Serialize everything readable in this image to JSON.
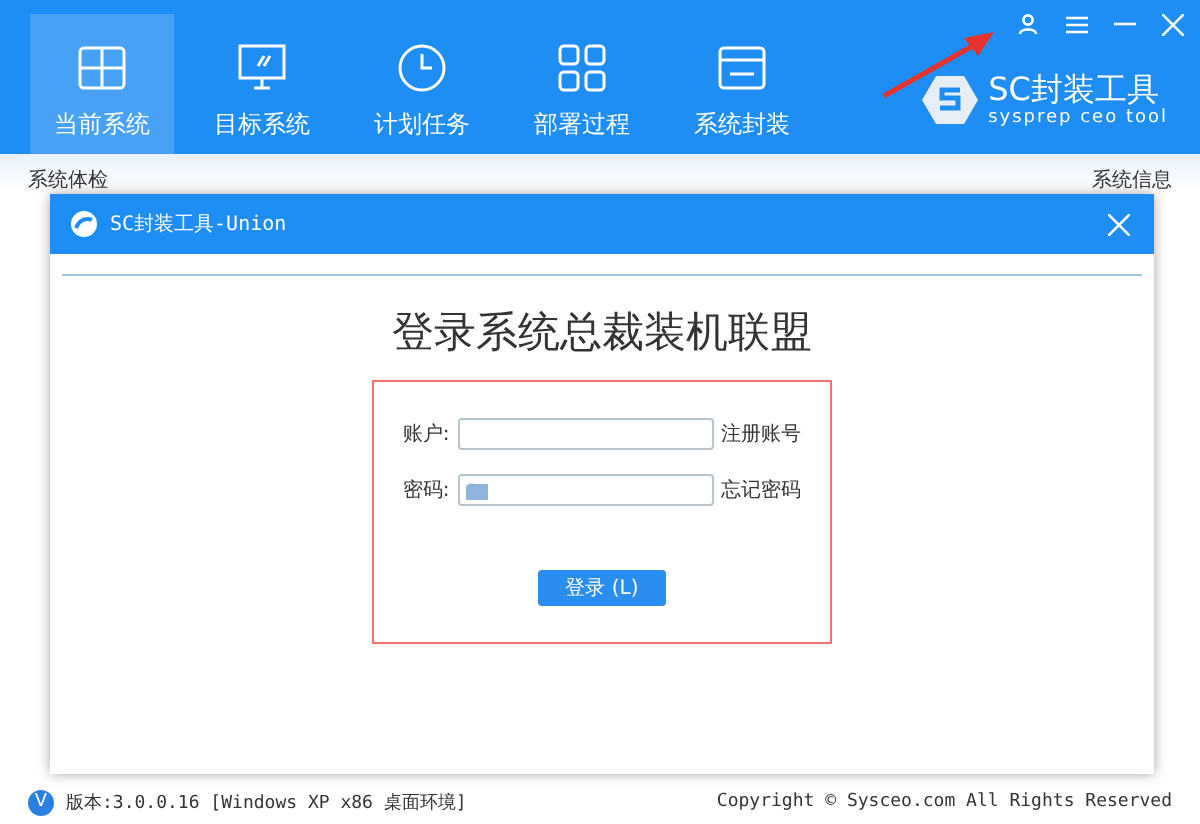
{
  "window": {
    "controls": [
      {
        "kind": "user"
      },
      {
        "kind": "menu"
      },
      {
        "kind": "minimize"
      },
      {
        "kind": "close"
      }
    ]
  },
  "tabs": [
    {
      "label": "当前系统",
      "selected": true
    },
    {
      "label": "目标系统",
      "selected": false
    },
    {
      "label": "计划任务",
      "selected": false
    },
    {
      "label": "部署过程",
      "selected": false
    },
    {
      "label": "系统封装",
      "selected": false
    }
  ],
  "logo": {
    "name": "SC封装工具",
    "tagline": "sysprep ceo tool"
  },
  "background": {
    "left_heading": "系统体检",
    "right_heading": "系统信息"
  },
  "dialog": {
    "title": "SC封装工具-Union",
    "heading": "登录系统总裁装机联盟",
    "fields": [
      {
        "kind": "text",
        "label": "账户:",
        "link": "注册账号"
      },
      {
        "kind": "password",
        "label": "密码:",
        "link": "忘记密码"
      }
    ],
    "button": "登录 (L)"
  },
  "status_bar": {
    "badge": "V",
    "version": "版本:3.0.0.16 [Windows XP x86 桌面环境]",
    "copyright": "Copyright © Sysceo.com All Rights Reserved"
  }
}
